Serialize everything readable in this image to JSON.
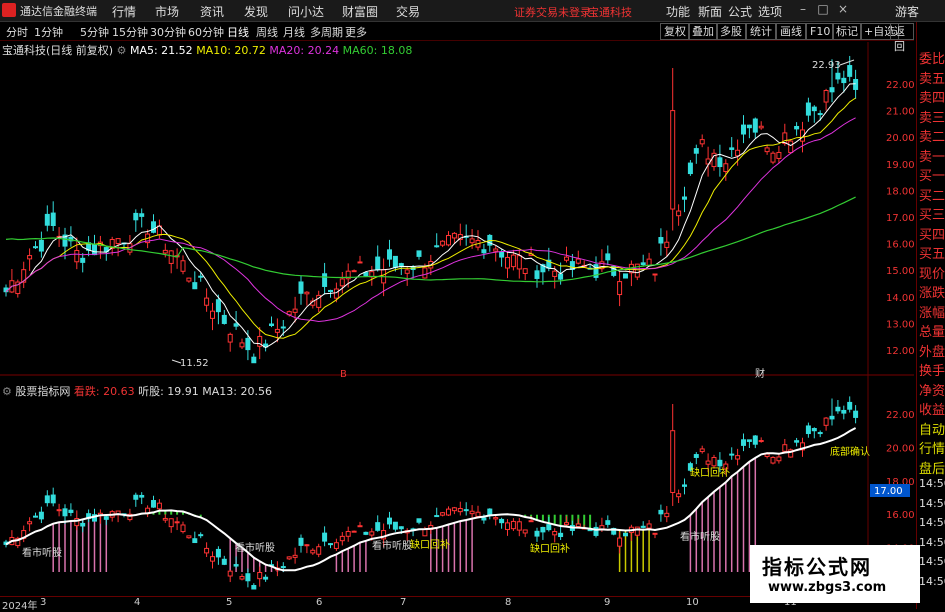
{
  "topbar": {
    "app_name": "通达信金融终端",
    "menus": [
      "行情",
      "市场",
      "资讯",
      "发现",
      "问小达",
      "财富圈",
      "交易"
    ],
    "warning": "证券交易未登录",
    "stock": "宝通科技",
    "right_menus": [
      "功能",
      "斯面",
      "公式",
      "选项"
    ],
    "guest": "游客"
  },
  "toolbar": {
    "periods": [
      "分时",
      "1分钟",
      "5分钟",
      "15分钟",
      "30分钟",
      "60分钟",
      "日线",
      "周线",
      "月线",
      "多周期",
      "更多"
    ],
    "active_period": "日线",
    "buttons": [
      "复权",
      "叠加",
      "多股",
      "统计",
      "画线",
      "F10",
      "标记",
      "+自选",
      "返回"
    ]
  },
  "main_legend": {
    "title": "宝通科技(日线 前复权)",
    "ma5": "MA5: 21.52",
    "ma10": "MA10: 20.72",
    "ma20": "MA20: 20.24",
    "ma60": "MA60: 18.08"
  },
  "sub_legend": {
    "title": "股票指标网",
    "v1": "看跌: 20.63",
    "v2": "听股: 19.91",
    "v3": "MA13: 20.56"
  },
  "main_axis": [
    "22.00",
    "21.00",
    "20.00",
    "19.00",
    "18.00",
    "17.00",
    "16.00",
    "15.00",
    "14.00",
    "13.00",
    "12.00"
  ],
  "sub_axis": [
    "22.00",
    "20.00",
    "18.00",
    "16.00",
    "14.00"
  ],
  "sub_price_tag": "17.00",
  "annotations": {
    "high": "22.93",
    "low": "11.52",
    "marker_b": "B",
    "marker_cai": "财",
    "sub_labels": [
      "看市听股",
      "看市听股",
      "看市听股",
      "看市听股",
      "缺口回补",
      "缺口回补",
      "缺口回补",
      "底部确认"
    ]
  },
  "right_panel": [
    "委比",
    "卖五",
    "卖四",
    "卖三",
    "卖二",
    "卖一",
    "买一",
    "买二",
    "买三",
    "买四",
    "买五",
    "现价",
    "涨跌",
    "涨幅",
    "总量",
    "外盘",
    "换手",
    "净资",
    "收益",
    "自动",
    "行情",
    "盘后",
    "14:50",
    "14:50",
    "14:50",
    "14:50",
    "14:50",
    "14:50"
  ],
  "x_axis": {
    "year_label": "2024年",
    "months": [
      "3",
      "4",
      "5",
      "6",
      "7",
      "8",
      "9",
      "10",
      "11"
    ]
  },
  "watermark": {
    "line1": "指标公式网",
    "line2": "www.zbgs3.com"
  },
  "colors": {
    "up": "#ff3333",
    "down": "#33dddd",
    "ma5": "#ffffff",
    "ma10": "#eeee00",
    "ma20": "#dd33dd",
    "ma60": "#33cc33"
  }
}
